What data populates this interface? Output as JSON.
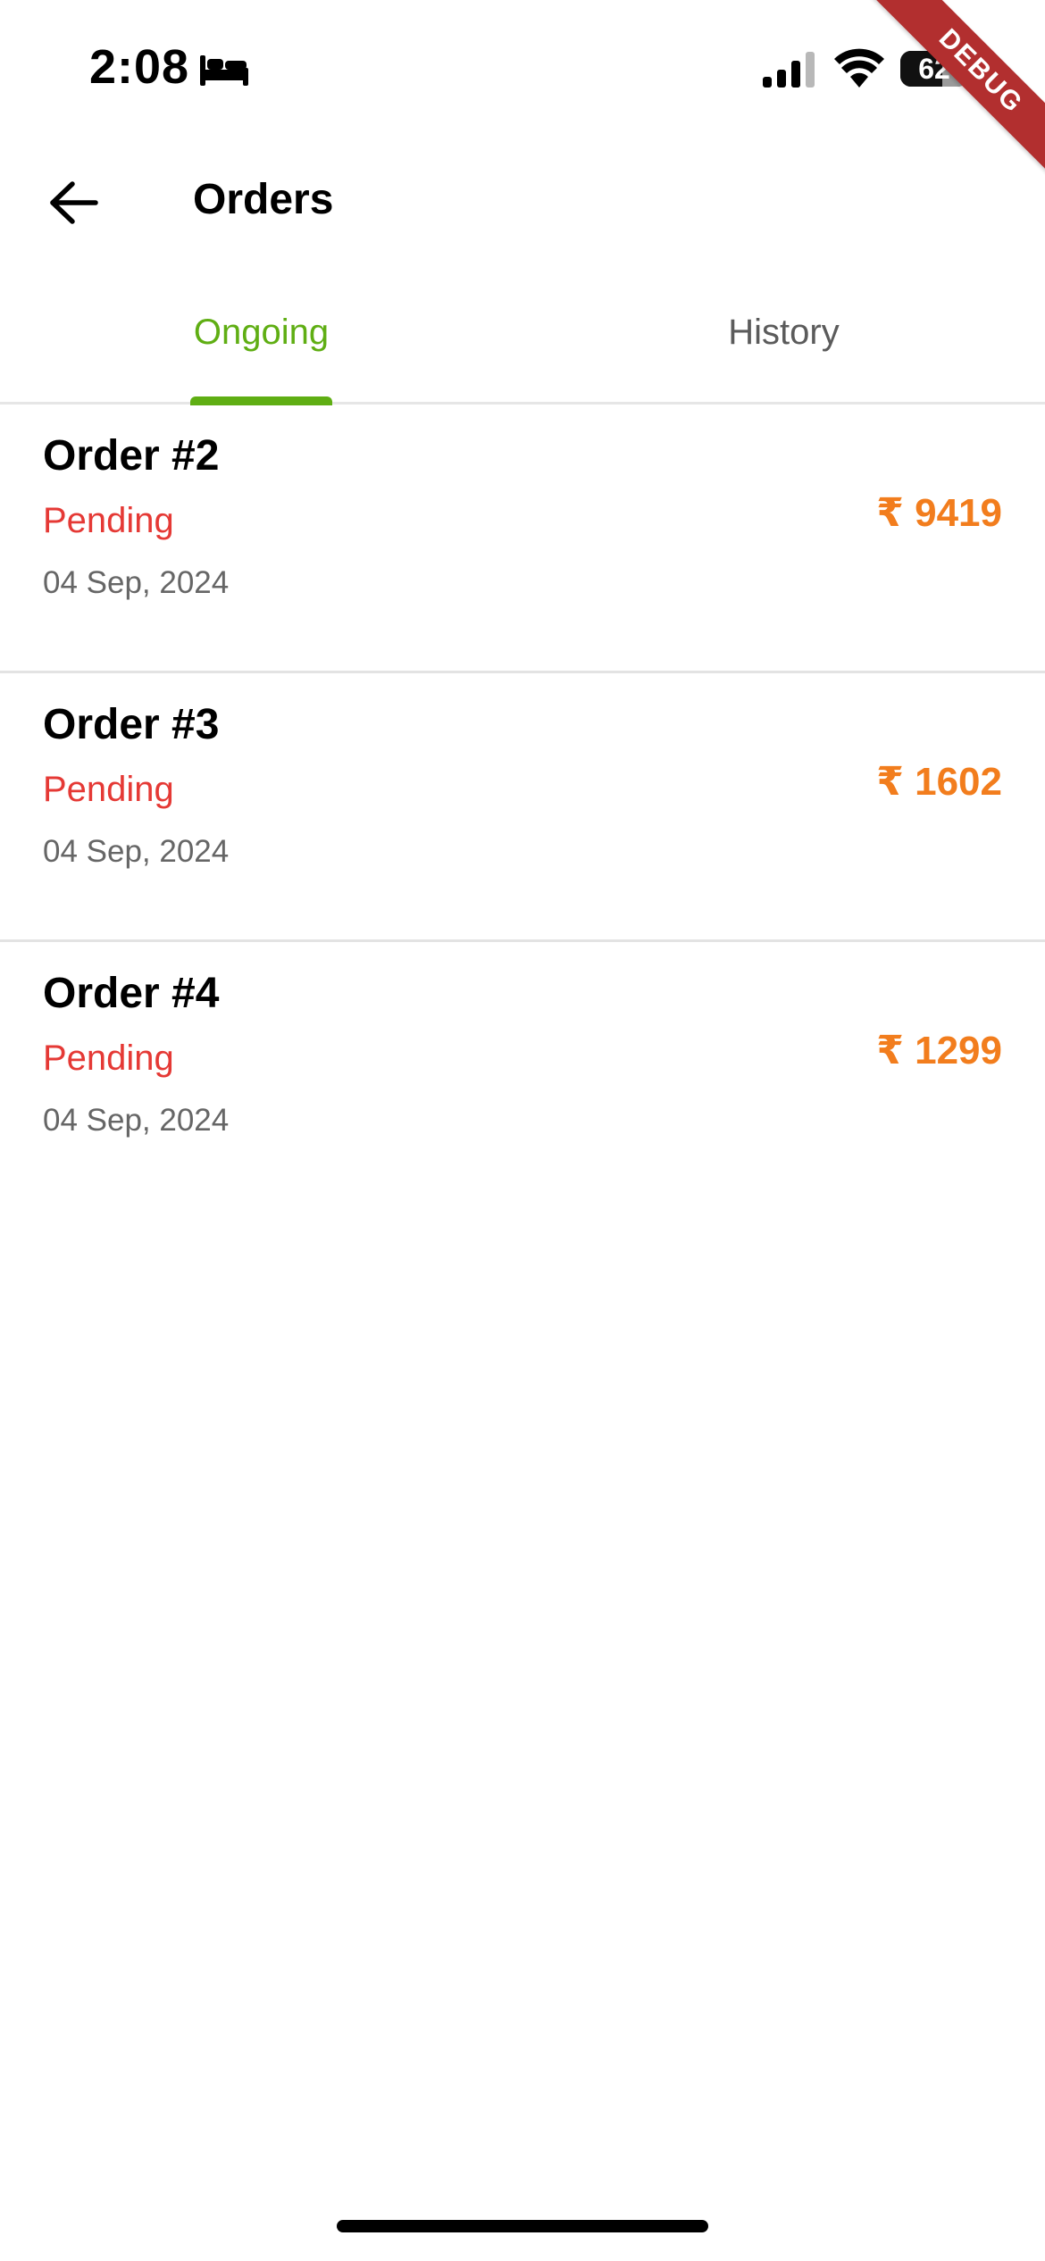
{
  "status_bar": {
    "time": "2:08",
    "battery_level": "62",
    "battery_percent": 62
  },
  "debug_banner": "DEBUG",
  "app_bar": {
    "title": "Orders"
  },
  "tabs": [
    {
      "label": "Ongoing",
      "active": true
    },
    {
      "label": "History",
      "active": false
    }
  ],
  "orders": [
    {
      "title": "Order #2",
      "status": "Pending",
      "date": "04 Sep, 2024",
      "amount": "₹ 9419"
    },
    {
      "title": "Order #3",
      "status": "Pending",
      "date": "04 Sep, 2024",
      "amount": "₹ 1602"
    },
    {
      "title": "Order #4",
      "status": "Pending",
      "date": "04 Sep, 2024",
      "amount": "₹ 1299"
    }
  ],
  "colors": {
    "accent_green": "#5fae13",
    "status_pending": "#e53935",
    "amount_orange": "#f27d1d"
  },
  "icons": {
    "back": "arrow-left-icon",
    "sleep": "bed-icon",
    "signal": "signal-icon",
    "wifi": "wifi-icon",
    "battery": "battery-icon"
  }
}
